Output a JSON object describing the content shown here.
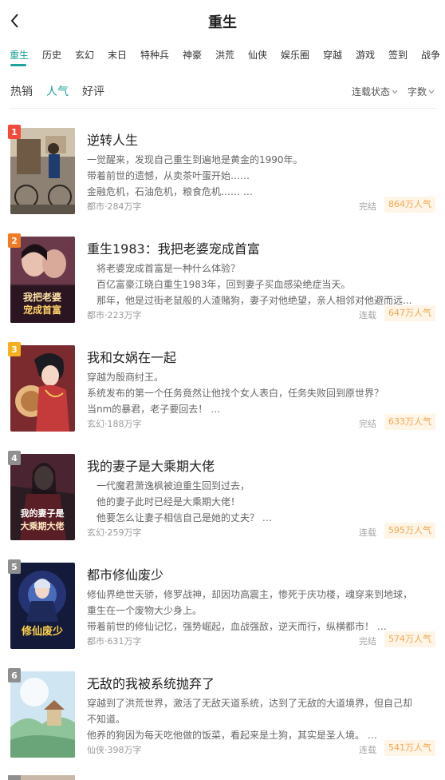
{
  "header": {
    "title": "重生"
  },
  "categories": [
    {
      "label": "重生"
    },
    {
      "label": "历史"
    },
    {
      "label": "玄幻"
    },
    {
      "label": "末日"
    },
    {
      "label": "特种兵"
    },
    {
      "label": "神豪"
    },
    {
      "label": "洪荒"
    },
    {
      "label": "仙侠"
    },
    {
      "label": "娱乐圈"
    },
    {
      "label": "穿越"
    },
    {
      "label": "游戏"
    },
    {
      "label": "签到"
    },
    {
      "label": "战争"
    }
  ],
  "sort": {
    "hot": "热销",
    "popular": "人气",
    "rating": "好评"
  },
  "filters": {
    "status": "连载状态",
    "words": "字数"
  },
  "colors": {
    "accent": "#1aa39a",
    "pop_text": "#f2a650",
    "pop_bg": "#fff5e6"
  },
  "books": [
    {
      "rank": "1",
      "title": "逆转人生",
      "desc": [
        "一觉醒来，发现自己重生到遍地是黄金的1990年。",
        "带着前世的遗憾，从卖茶叶蛋开始……",
        "金融危机，石油危机，粮食危机…… …"
      ],
      "genre": "都市",
      "words": "284万字",
      "status": "完结",
      "popularity": "864万人气"
    },
    {
      "rank": "2",
      "title": "重生1983：我把老婆宠成首富",
      "desc": [
        "将老婆宠成首富是一种什么体验？",
        "百亿富豪江晓白重生1983年，回到妻子买血感染绝症当天。",
        "那年，他是过街老鼠般的人渣赌狗，妻子对他绝望，亲人相邻对他避而远..."
      ],
      "genre": "都市",
      "words": "223万字",
      "status": "连载",
      "popularity": "647万人气",
      "cover_text": [
        "我把老婆",
        "宠成首富"
      ]
    },
    {
      "rank": "3",
      "title": "我和女娲在一起",
      "desc": [
        "穿越为殷商纣王。",
        "系统发布的第一个任务竟然让他找个女人表白，任务失败回到原世界？",
        "当nm的暴君，老子要回去！ …"
      ],
      "genre": "玄幻",
      "words": "188万字",
      "status": "完结",
      "popularity": "633万人气"
    },
    {
      "rank": "4",
      "title": "我的妻子是大乘期大佬",
      "desc": [
        "一代魔君萧逸枫被迫重生回到过去，",
        "他的妻子此时已经是大乘期大佬！",
        "他要怎么让妻子相信自己是她的丈夫？ …"
      ],
      "genre": "玄幻",
      "words": "259万字",
      "status": "连载",
      "popularity": "595万人气",
      "cover_text": [
        "我的妻子是",
        "大乘期大佬"
      ]
    },
    {
      "rank": "5",
      "title": "都市修仙废少",
      "desc": [
        "修仙界绝世天骄，修罗战神，却因功高震主，惨死于庆功楼，魂穿来到地球，",
        "重生在一个废物大少身上。",
        "带着前世的修仙记忆，强势崛起，血战强敌，逆天而行，纵横都市！ …"
      ],
      "genre": "都市",
      "words": "631万字",
      "status": "完结",
      "popularity": "574万人气",
      "cover_text": [
        "修仙废少"
      ]
    },
    {
      "rank": "6",
      "title": "无敌的我被系统抛弃了",
      "desc": [
        "穿越到了洪荒世界，激活了无敌天道系统，达到了无敌的大道境界，但自己却",
        "不知道。",
        "他养的狗因为每天吃他做的饭菜，看起来是土狗，其实是圣人境。 …"
      ],
      "genre": "仙侠",
      "words": "398万字",
      "status": "连载",
      "popularity": "541万人气"
    }
  ]
}
